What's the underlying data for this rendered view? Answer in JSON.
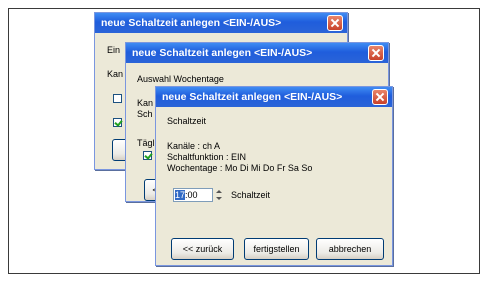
{
  "window_title": "neue Schaltzeit anlegen <EIN-/AUS>",
  "back_window": {
    "label_top": "Ein",
    "label_kan": "Kan"
  },
  "middle_window": {
    "heading": "Auswahl Wochentage",
    "label_kan": "Kan",
    "label_sch": "Sch",
    "label_taeglich": "Täglic",
    "btn_partial": "<"
  },
  "front_window": {
    "heading": "Schaltzeit",
    "kanaele": "Kanäle : ch A",
    "schaltfunktion": "Schaltfunktion : EIN",
    "wochentage": "Wochentage : Mo Di Mi Do Fr Sa So",
    "time_hour": "17",
    "time_rest": ":00",
    "time_label": "Schaltzeit",
    "buttons": {
      "back": "<< zurück",
      "finish": "fertigstellen",
      "cancel": "abbrechen"
    }
  }
}
